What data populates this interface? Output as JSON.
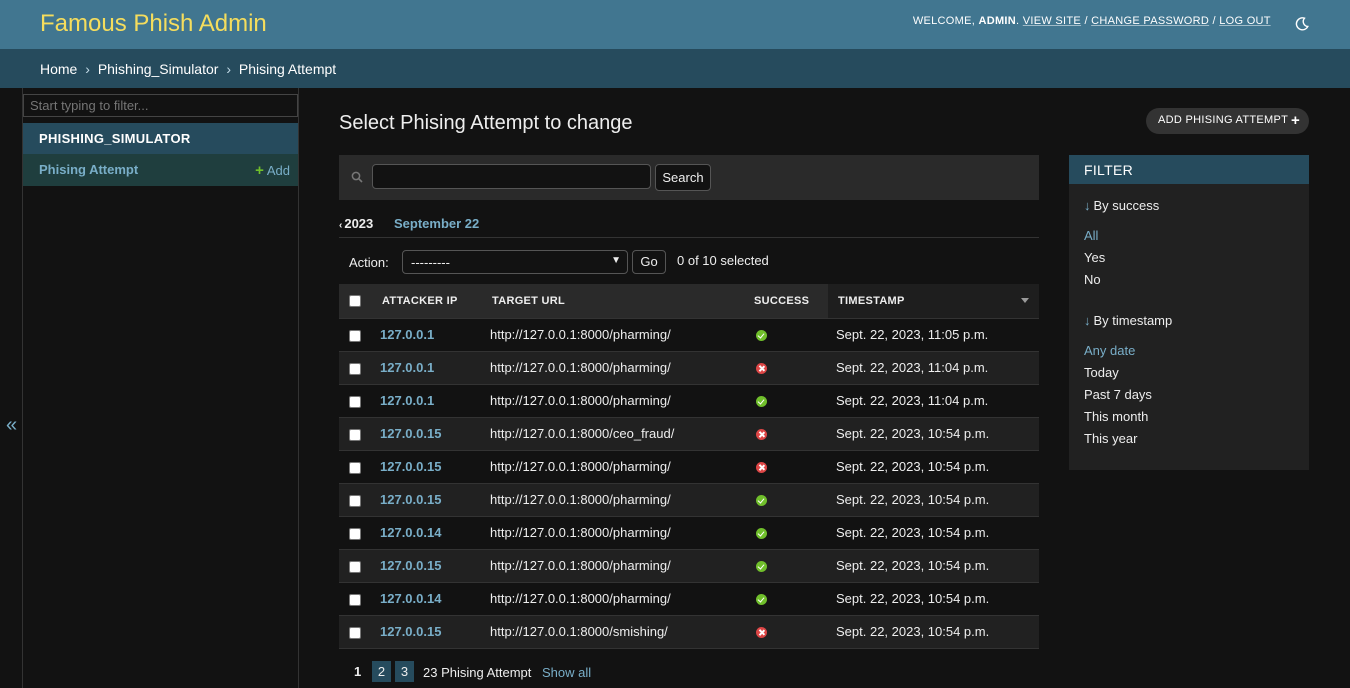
{
  "header": {
    "site_name": "Famous Phish Admin",
    "welcome": "WELCOME,",
    "username": "ADMIN",
    "links": [
      "VIEW SITE",
      "CHANGE PASSWORD",
      "LOG OUT"
    ],
    "separator": "/"
  },
  "breadcrumbs": {
    "items": [
      "Home",
      "Phishing_Simulator",
      "Phising Attempt"
    ],
    "sep": "›"
  },
  "sidebar": {
    "filter_placeholder": "Start typing to filter...",
    "app_name": "PHISHING_SIMULATOR",
    "model_name": "Phising Attempt",
    "add_label": "Add",
    "collapse_glyph": "«"
  },
  "main": {
    "title": "Select Phising Attempt to change",
    "add_button": "ADD PHISING ATTEMPT",
    "search_button": "Search",
    "date_back": "2023",
    "date_current": "September 22",
    "action_label": "Action:",
    "action_value": "---------",
    "go_button": "Go",
    "selected": "0 of 10 selected"
  },
  "table": {
    "headers": [
      "ATTACKER IP",
      "TARGET URL",
      "SUCCESS",
      "TIMESTAMP"
    ],
    "rows": [
      {
        "ip": "127.0.0.1",
        "url": "http://127.0.0.1:8000/pharming/",
        "success": true,
        "ts": "Sept. 22, 2023, 11:05 p.m."
      },
      {
        "ip": "127.0.0.1",
        "url": "http://127.0.0.1:8000/pharming/",
        "success": false,
        "ts": "Sept. 22, 2023, 11:04 p.m."
      },
      {
        "ip": "127.0.0.1",
        "url": "http://127.0.0.1:8000/pharming/",
        "success": true,
        "ts": "Sept. 22, 2023, 11:04 p.m."
      },
      {
        "ip": "127.0.0.15",
        "url": "http://127.0.0.1:8000/ceo_fraud/",
        "success": false,
        "ts": "Sept. 22, 2023, 10:54 p.m."
      },
      {
        "ip": "127.0.0.15",
        "url": "http://127.0.0.1:8000/pharming/",
        "success": false,
        "ts": "Sept. 22, 2023, 10:54 p.m."
      },
      {
        "ip": "127.0.0.15",
        "url": "http://127.0.0.1:8000/pharming/",
        "success": true,
        "ts": "Sept. 22, 2023, 10:54 p.m."
      },
      {
        "ip": "127.0.0.14",
        "url": "http://127.0.0.1:8000/pharming/",
        "success": true,
        "ts": "Sept. 22, 2023, 10:54 p.m."
      },
      {
        "ip": "127.0.0.15",
        "url": "http://127.0.0.1:8000/pharming/",
        "success": true,
        "ts": "Sept. 22, 2023, 10:54 p.m."
      },
      {
        "ip": "127.0.0.14",
        "url": "http://127.0.0.1:8000/pharming/",
        "success": true,
        "ts": "Sept. 22, 2023, 10:54 p.m."
      },
      {
        "ip": "127.0.0.15",
        "url": "http://127.0.0.1:8000/smishing/",
        "success": false,
        "ts": "Sept. 22, 2023, 10:54 p.m."
      }
    ]
  },
  "paginator": {
    "current": "1",
    "pages": [
      "2",
      "3"
    ],
    "total": "23 Phising Attempt",
    "show_all": "Show all"
  },
  "filter": {
    "title": "FILTER",
    "groups": [
      {
        "heading": "By success",
        "options": [
          "All",
          "Yes",
          "No"
        ],
        "selected": 0
      },
      {
        "heading": "By timestamp",
        "options": [
          "Any date",
          "Today",
          "Past 7 days",
          "This month",
          "This year"
        ],
        "selected": 0
      }
    ],
    "arrow": "↓"
  },
  "colors": {
    "header_bg": "#417690",
    "breadcrumb_bg": "#264b5d",
    "brand_text": "#f5dd5d",
    "link": "#79aec8",
    "success": "#70bf2b",
    "failure": "#dd4646"
  }
}
